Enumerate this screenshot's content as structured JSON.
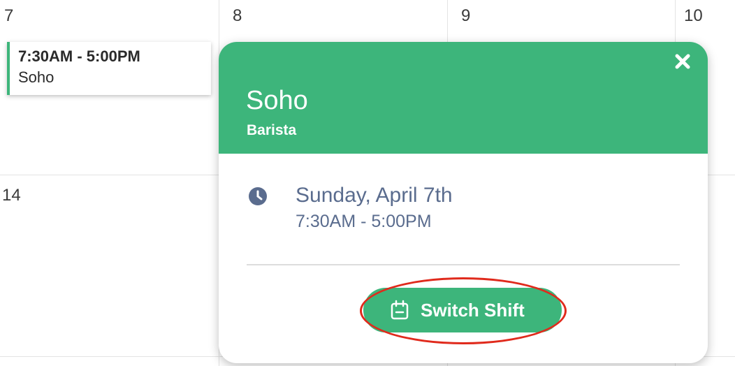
{
  "calendar": {
    "week1": [
      "7",
      "8",
      "9",
      "10"
    ],
    "week2": [
      "14"
    ]
  },
  "shift_card": {
    "time": "7:30AM - 5:00PM",
    "location": "Soho"
  },
  "popup": {
    "title": "Soho",
    "role": "Barista",
    "date": "Sunday, April 7th",
    "time": "7:30AM - 5:00PM",
    "close_icon": "close-icon",
    "clock_icon": "clock-icon",
    "action_button": {
      "label": "Switch Shift",
      "icon": "calendar-icon"
    }
  },
  "colors": {
    "accent": "#3db57b",
    "text_detail": "#5a6c8e",
    "highlight": "#e02a1c"
  }
}
